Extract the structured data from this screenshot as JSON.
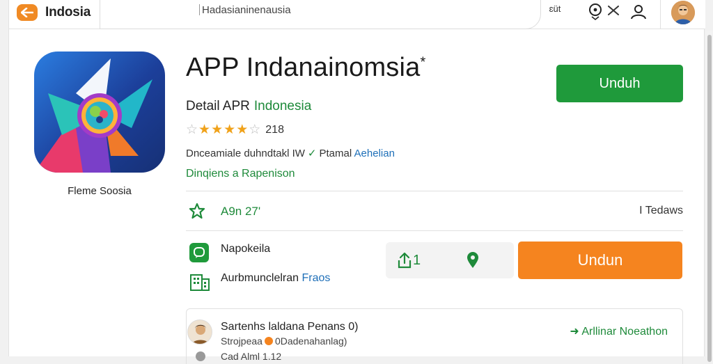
{
  "header": {
    "brand": "Indosia",
    "search_text": "Hadasianinenausia",
    "lang_label": "ɛüt",
    "icons": [
      "logo-icon",
      "clear-icon",
      "search-icon",
      "user-icon",
      "avatar"
    ]
  },
  "app": {
    "title": "APP Indanainomsia",
    "title_mark": "*",
    "caption": "Fleme Soosia",
    "detail_label": "Detail APR",
    "detail_link": "Indonesia",
    "rating_stars": 4,
    "rating_max": 5,
    "rating_count": "218",
    "meta_text": "Dnceamiale duhndtakl IW",
    "meta_check": "✓",
    "meta_plain": "Ptamal",
    "meta_link": "Aehelian",
    "sub_link": "Dinqiens  a  Rapenison",
    "primary_button": "Unduh"
  },
  "stats": {
    "version": "A9n 27'",
    "right_label": "I Tedaws"
  },
  "features": {
    "item_a": "Napokeila",
    "item_b": "Aurbmunclelran",
    "item_b_link": "Fraos"
  },
  "actions": {
    "share_count": "1",
    "download_button": "Undun"
  },
  "review": {
    "name": "Sartenhs laldana Penans 0)",
    "sub_prefix": "Strojpeaa",
    "sub_suffix": "0Dadenahanlag)",
    "action": "Arllinar Noeathon",
    "peek": "Cad  Alml  1.12"
  },
  "colors": {
    "accent_green": "#1f9a3b",
    "accent_orange": "#f5841f",
    "link_blue": "#1e6fb8",
    "star": "#f0a21a"
  }
}
